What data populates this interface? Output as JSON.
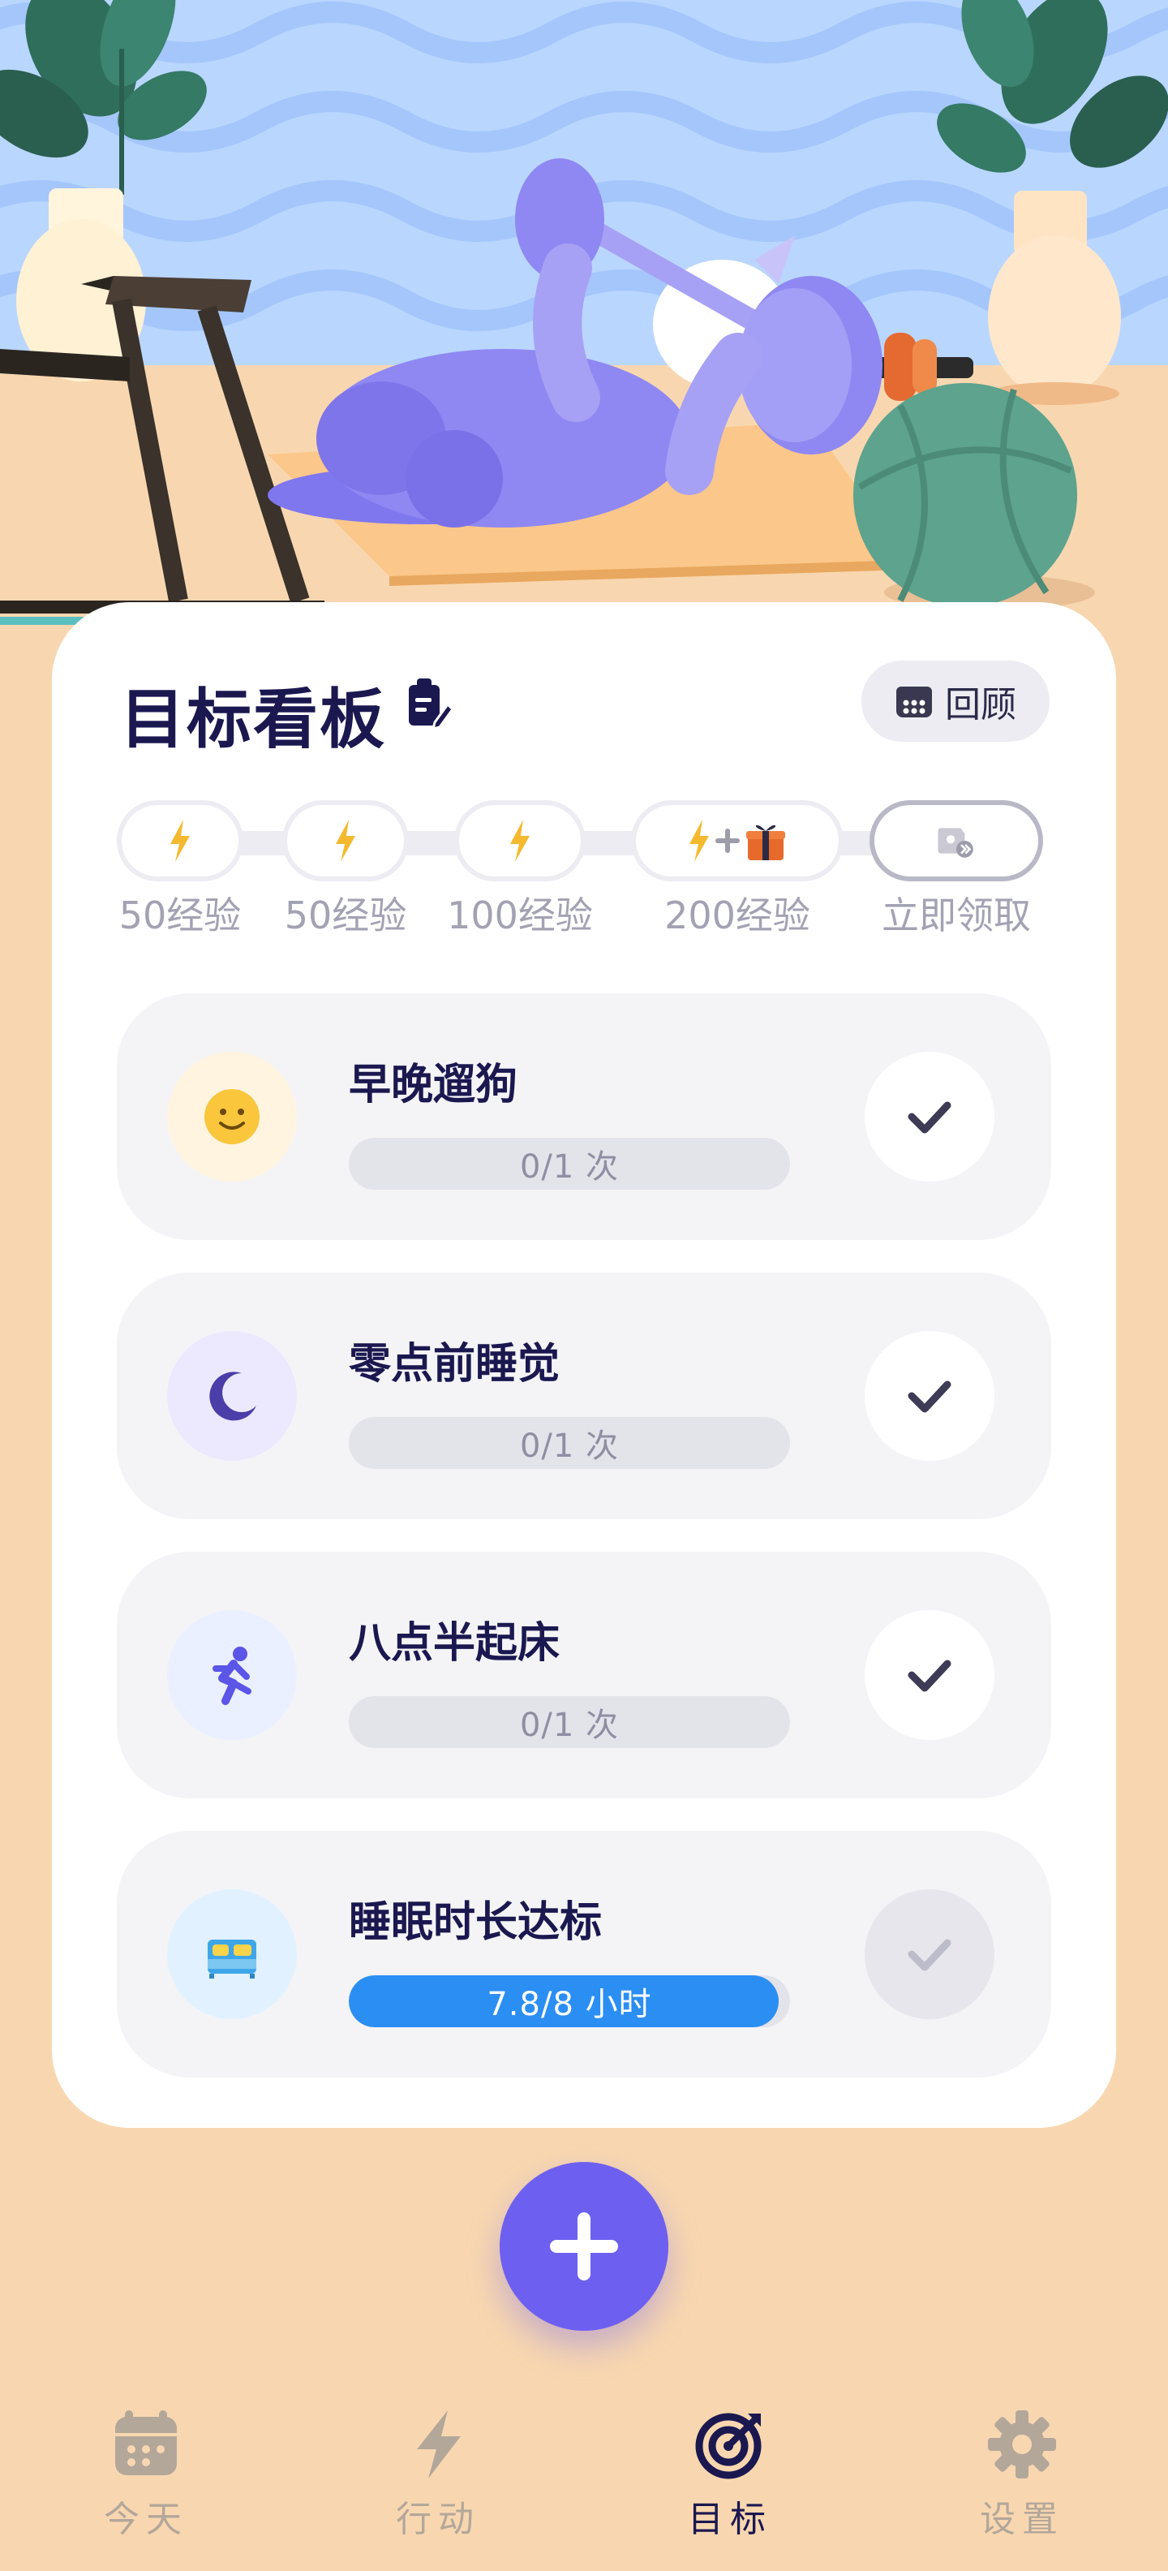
{
  "board": {
    "title": "目标看板",
    "review_label": "回顾"
  },
  "rewards": {
    "milestones": [
      {
        "label": "50经验",
        "icon": "lightning-icon"
      },
      {
        "label": "50经验",
        "icon": "lightning-icon"
      },
      {
        "label": "100经验",
        "icon": "lightning-icon"
      },
      {
        "label": "200经验",
        "icon": "lightning-gift-icon"
      },
      {
        "label": "立即领取",
        "icon": "claim-ticket-icon"
      }
    ]
  },
  "goals": [
    {
      "name": "早晚遛狗",
      "progress_text": "0/1 次",
      "progress": 0,
      "icon": "smiley-icon",
      "completed": false
    },
    {
      "name": "零点前睡觉",
      "progress_text": "0/1 次",
      "progress": 0,
      "icon": "moon-icon",
      "completed": false
    },
    {
      "name": "八点半起床",
      "progress_text": "0/1 次",
      "progress": 0,
      "icon": "running-icon",
      "completed": false
    },
    {
      "name": "睡眠时长达标",
      "progress_text": "7.8/8 小时",
      "progress": 0.975,
      "icon": "bed-icon",
      "completed": false
    }
  ],
  "nav": {
    "items": [
      {
        "label": "今天",
        "icon": "calendar-icon",
        "active": false
      },
      {
        "label": "行动",
        "icon": "lightning-icon",
        "active": false
      },
      {
        "label": "目标",
        "icon": "target-icon",
        "active": true
      },
      {
        "label": "设置",
        "icon": "gear-icon",
        "active": false
      }
    ]
  },
  "colors": {
    "accent": "#6d5ff0",
    "progress_fill": "#2b8ef3",
    "background": "#f8d7b0",
    "title": "#1b1850"
  }
}
